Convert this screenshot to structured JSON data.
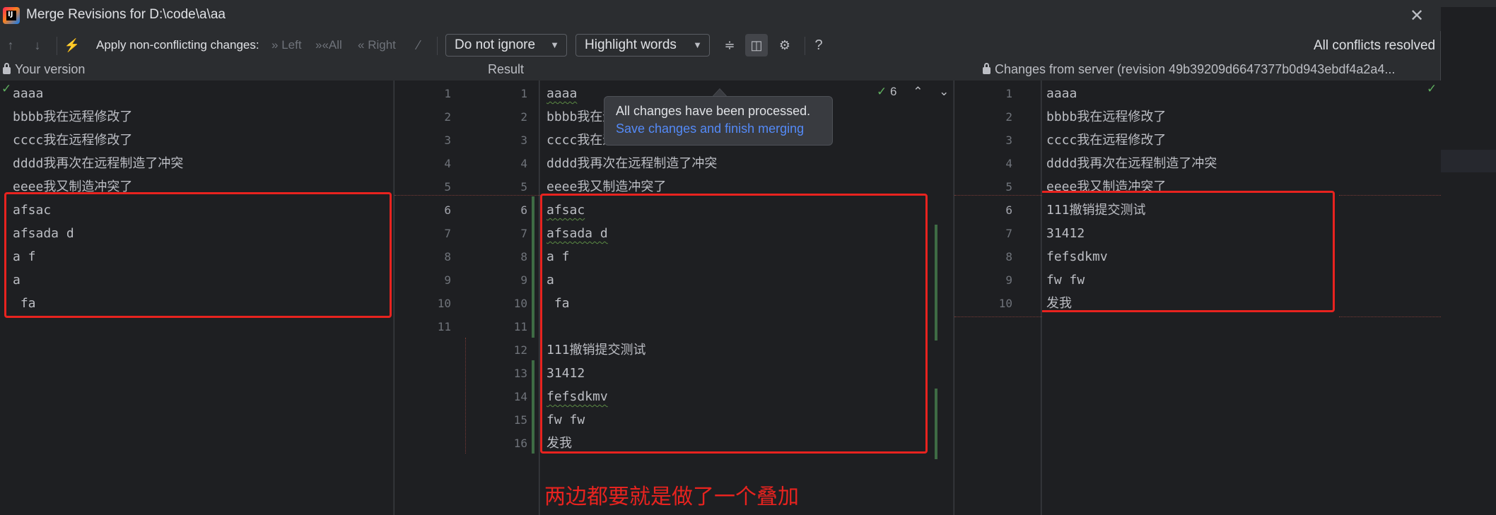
{
  "window": {
    "title": "Merge Revisions for D:\\code\\a\\aa",
    "app_logo": "IJ"
  },
  "toolbar": {
    "apply_label": "Apply non-conflicting changes:",
    "left_label": "Left",
    "all_label": "All",
    "right_label": "Right",
    "ignore_combo": "Do not ignore",
    "highlight_combo": "Highlight words",
    "help": "?",
    "status": "All conflicts resolved"
  },
  "headers": {
    "left": "Your version",
    "middle": "Result",
    "right": "Changes from server (revision 49b39209d6647377b0d943ebdf4a2a4..."
  },
  "left_lines": [
    "aaaa",
    "bbbb我在远程修改了",
    "cccc我在远程修改了",
    "dddd我再次在远程制造了冲突",
    "eeee我又制造冲突了",
    "afsac",
    "afsada d",
    "a f",
    "a",
    " fa"
  ],
  "left_gutter_numbers": [
    "1",
    "2",
    "3",
    "4",
    "5",
    "6",
    "7",
    "8",
    "9",
    "10",
    "11"
  ],
  "result_gutter_numbers": [
    "1",
    "2",
    "3",
    "4",
    "5",
    "6",
    "7",
    "8",
    "9",
    "10",
    "11",
    "12",
    "13",
    "14",
    "15",
    "16"
  ],
  "result_lines": [
    "aaaa",
    "bbbb我在远程修改了",
    "cccc我在远程修改了",
    "dddd我再次在远程制造了冲突",
    "eeee我又制造冲突了",
    "afsac",
    "afsada d",
    "a f",
    "a",
    " fa",
    "",
    "111撤销提交测试",
    "31412",
    "fefsdkmv",
    "fw fw",
    "发我"
  ],
  "right_gutter_numbers": [
    "1",
    "2",
    "3",
    "4",
    "5",
    "6",
    "7",
    "8",
    "9",
    "10"
  ],
  "right_lines": [
    "aaaa",
    "bbbb我在远程修改了",
    "cccc我在远程修改了",
    "dddd我再次在远程制造了冲突",
    "eeee我又制造冲突了",
    "111撤销提交测试",
    "31412",
    "fefsdkmv",
    "fw fw",
    "发我"
  ],
  "nav": {
    "count": "6"
  },
  "popup": {
    "message": "All changes have been processed.",
    "link": "Save changes and finish merging"
  },
  "annotation": "两边都要就是做了一个叠加",
  "colors": {
    "annotation_red": "#e8231f",
    "link_blue": "#548af7",
    "check_green": "#5faf5f"
  }
}
